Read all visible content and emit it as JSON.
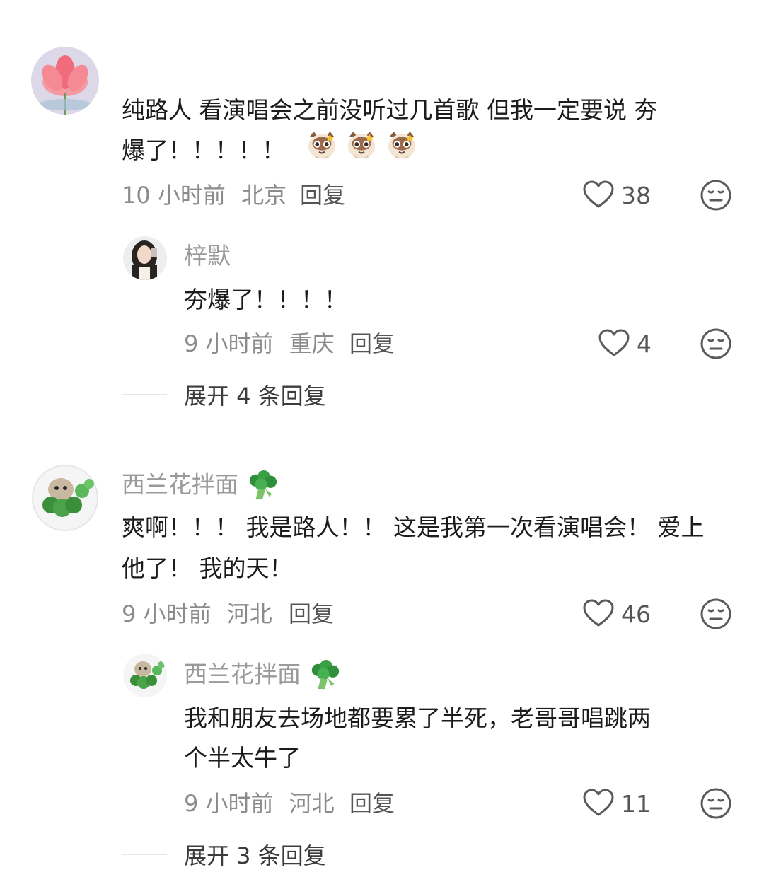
{
  "comments": [
    {
      "text_line1": "纯路人 看演唱会之前没听过几首歌 但我一定要说 夯",
      "text_line2": "爆了！！！！！",
      "emoji": "cat-emoji",
      "time": "10 小时前",
      "location": "北京",
      "reply_label": "回复",
      "likes": "38",
      "replies": [
        {
          "username": "梓默",
          "text_line1": "夯爆了！！！！",
          "time": "9 小时前",
          "location": "重庆",
          "reply_label": "回复",
          "likes": "4"
        }
      ],
      "expand_label": "展开 4 条回复"
    },
    {
      "username": "西兰花拌面",
      "username_icon": "broccoli-emoji",
      "text_line1": "爽啊！！！ 我是路人！！ 这是我第一次看演唱会！ 爱上",
      "text_line2": "他了！ 我的天！",
      "time": "9 小时前",
      "location": "河北",
      "reply_label": "回复",
      "likes": "46",
      "replies": [
        {
          "username": "西兰花拌面",
          "username_icon": "broccoli-emoji",
          "text_line1": "我和朋友去场地都要累了半死，老哥哥唱跳两",
          "text_line2": "个半太牛了",
          "time": "9 小时前",
          "location": "河北",
          "reply_label": "回复",
          "likes": "11"
        }
      ],
      "expand_label": "展开 3 条回复"
    }
  ],
  "colors": {
    "text": "#1b1b1b",
    "meta": "#8b8b8b",
    "username": "#9a9a9a",
    "icon": "#555555"
  }
}
